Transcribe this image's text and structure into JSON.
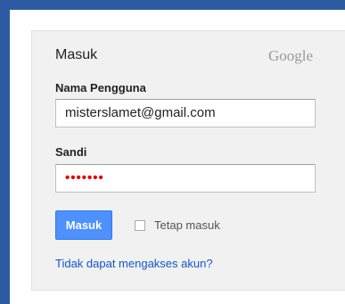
{
  "colors": {
    "frame_blue": "#2d5aa0",
    "panel_bg": "#f1f1f1",
    "button_blue": "#4d90fe",
    "link_blue": "#1155cc",
    "password_dots": "#e00000"
  },
  "form": {
    "title": "Masuk",
    "brand": "Google",
    "username_label": "Nama Pengguna",
    "username_value": "misterslamet@gmail.com",
    "password_label": "Sandi",
    "password_value": "•••••••",
    "submit_label": "Masuk",
    "remember_label": "Tetap masuk",
    "remember_checked": false,
    "help_link": "Tidak dapat mengakses akun?"
  }
}
